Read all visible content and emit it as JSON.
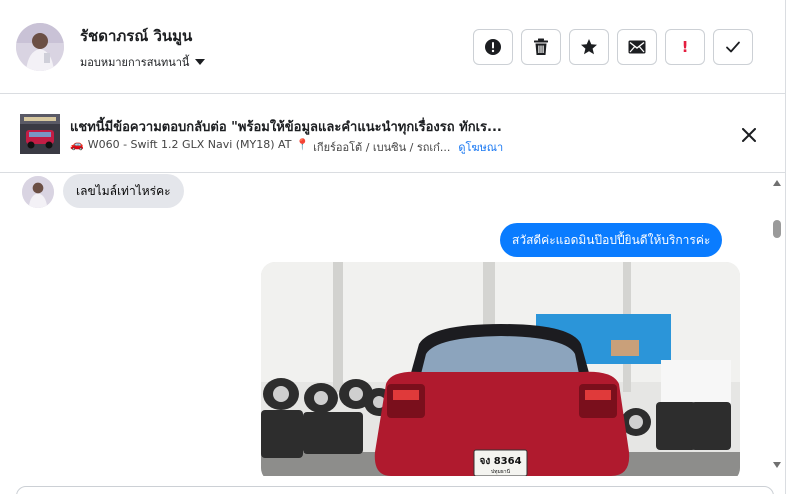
{
  "header": {
    "contact_name": "รัชดาภรณ์ วินมูน",
    "assign_label": "มอบหมายการสนทนานี้",
    "actions": [
      {
        "name": "mark-spam",
        "icon": "exclamation-circle-icon"
      },
      {
        "name": "delete",
        "icon": "trash-icon"
      },
      {
        "name": "star",
        "icon": "star-icon"
      },
      {
        "name": "mark-unread",
        "icon": "envelope-icon"
      },
      {
        "name": "follow-up",
        "icon": "exclamation-icon",
        "glyph": "!",
        "color": "#e41e3f"
      },
      {
        "name": "mark-done",
        "icon": "checkmark-icon"
      }
    ]
  },
  "ad_banner": {
    "title": "แชทนี้มีข้อความตอบกลับต่อ \"พร้อมให้ข้อมูลและคำแนะนำทุกเรื่องรถ ทักเร...",
    "car_emoji": "🚗",
    "details": "W060 - Swift 1.2 GLX Navi (MY18) AT",
    "pin_emoji": "📍",
    "details_tail": "เกียร์ออโต้ / เบนซิน / รถเก๋...",
    "link": "ดูโฆษณา"
  },
  "messages": [
    {
      "direction": "incoming",
      "text": "เลขไมล์เท่าไหร่คะ"
    },
    {
      "direction": "outgoing",
      "text": "สวัสดีค่ะแอดมินป๊อปปี้ยินดีให้บริการค่ะ"
    },
    {
      "direction": "outgoing",
      "type": "image",
      "plate_line1": "จง 8364",
      "plate_line2": "ปทุมธานี"
    }
  ],
  "colors": {
    "accent_blue": "#0a7cff",
    "link_blue": "#1877f2",
    "incoming_bubble": "#e4e6eb",
    "border": "#dadde1",
    "car_red": "#b01a2e"
  }
}
